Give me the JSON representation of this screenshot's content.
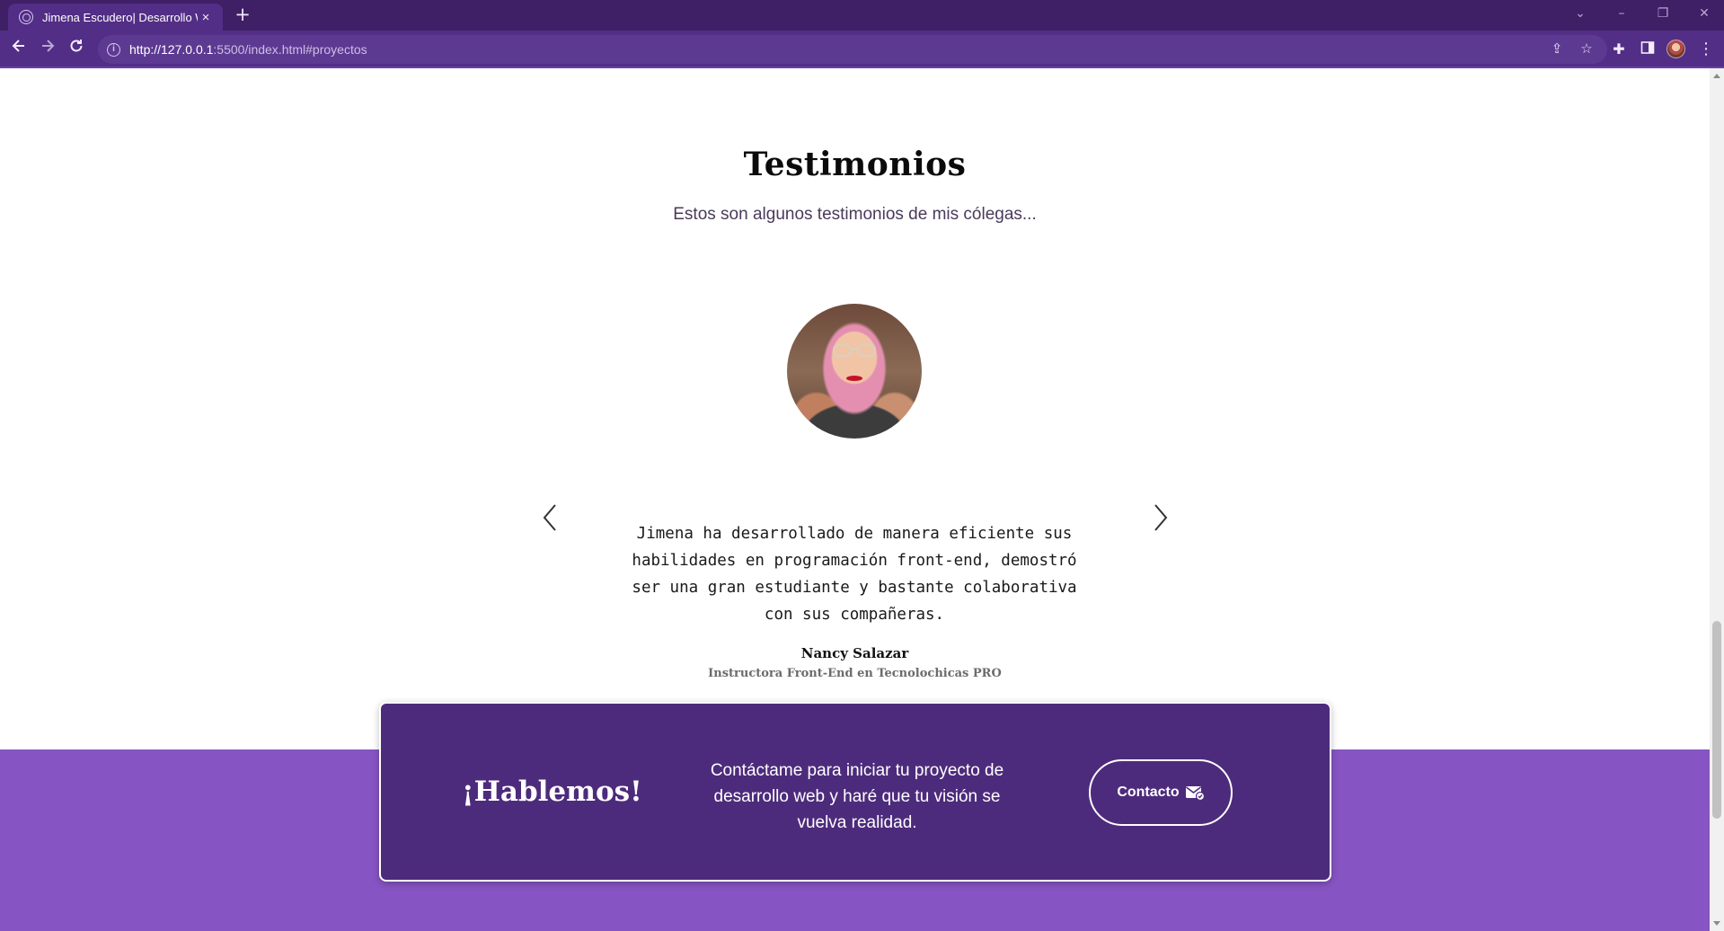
{
  "browser": {
    "tab_title": "Jimena Escudero| Desarrollo Web",
    "tab_close": "×",
    "new_tab": "+",
    "url_host": "http://127.0.0.1",
    "url_rest": ":5500/index.html#proyectos",
    "icons": [
      "back-icon",
      "forward-icon",
      "reload-icon",
      "info-icon",
      "share-icon",
      "star-icon",
      "extensions-icon",
      "side-panel-icon",
      "profile-avatar",
      "menu-icon"
    ]
  },
  "testimonials": {
    "title": "Testimonios",
    "subtitle": "Estos son algunos testimonios de mis cólegas...",
    "quote": "Jimena ha desarrollado de manera eficiente sus habilidades en programación front-end, demostró ser una gran estudiante y bastante colaborativa con sus compañeras.",
    "author_name": "Nancy Salazar",
    "author_role": "Instructora Front-End en Tecnolochicas PRO"
  },
  "cta": {
    "title": "¡Hablemos!",
    "text": "Contáctame para iniciar tu proyecto de desarrollo web y haré que tu visión se vuelva realidad.",
    "button_label": "Contacto"
  },
  "colors": {
    "chrome_dark": "#3f1f66",
    "chrome": "#522e86",
    "footer_band": "#8654c3",
    "cta_card": "#4d2b7c"
  }
}
